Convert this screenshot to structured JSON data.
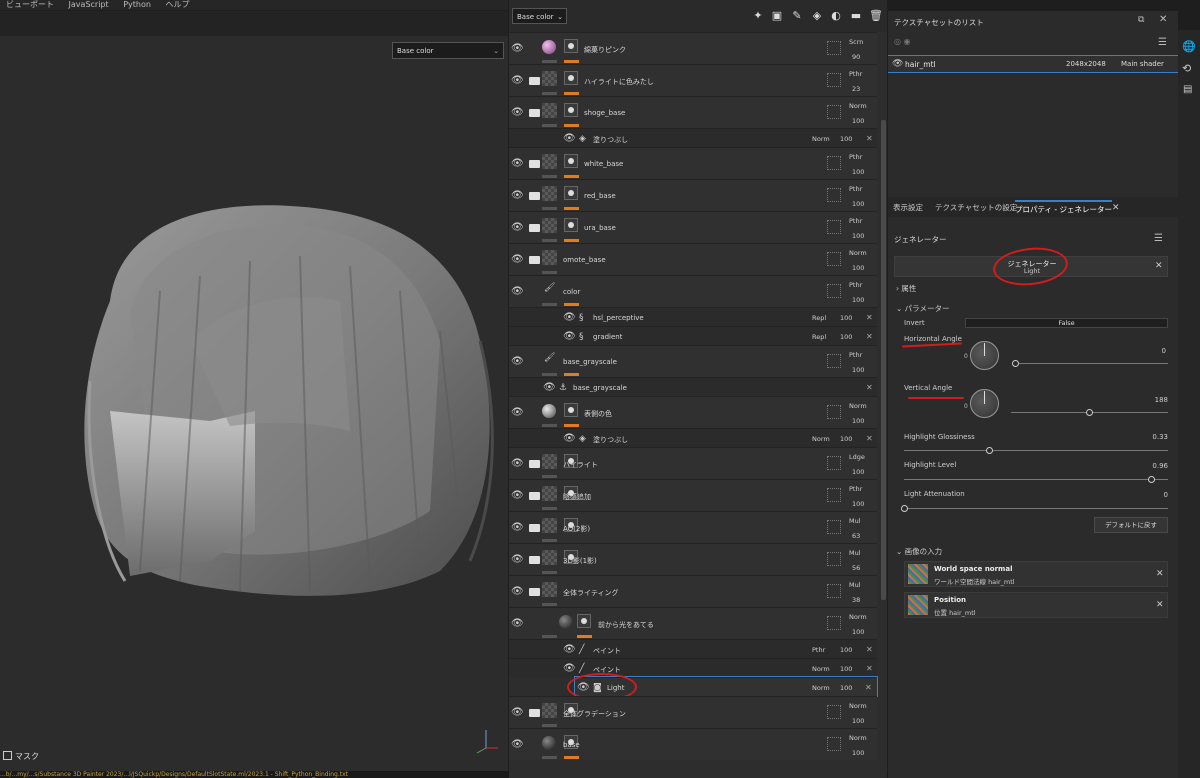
{
  "menu": [
    "ビューポート",
    "JavaScript",
    "Python",
    "ヘルプ"
  ],
  "viewport": {
    "channel_select": "Base color",
    "mask_label": "マスク",
    "status_text": "...b/...my/...s/Substance 3D Painter 2023/...l/JSQuickp/Designs/DefaultSlotState.ml/2023.1 - Shift_Python_Binding.txt"
  },
  "layers_toolbar": {
    "channel_select": "Base color",
    "icons": [
      "brush-effects-icon",
      "add-fill-icon",
      "paint-icon",
      "fill-icon",
      "mask-icon",
      "folder-icon",
      "trash-icon"
    ]
  },
  "layers": [
    {
      "name": "綿菓りピンク",
      "blend": "Scrn",
      "opacity": "90",
      "visible": true,
      "kind": "sphere-pink"
    },
    {
      "name": "ハイライトに色みたし",
      "blend": "Pthr",
      "opacity": "23",
      "visible": true,
      "kind": "folder"
    },
    {
      "name": "shoge_base",
      "blend": "Norm",
      "opacity": "100",
      "visible": true,
      "kind": "folder"
    },
    {
      "name": "塗りつぶし",
      "blend": "Norm",
      "opacity": "100",
      "visible": true,
      "kind": "fill-sub"
    },
    {
      "name": "white_base",
      "blend": "Pthr",
      "opacity": "100",
      "visible": true,
      "kind": "folder"
    },
    {
      "name": "red_base",
      "blend": "Pthr",
      "opacity": "100",
      "visible": true,
      "kind": "folder"
    },
    {
      "name": "ura_base",
      "blend": "Pthr",
      "opacity": "100",
      "visible": true,
      "kind": "folder"
    },
    {
      "name": "omote_base",
      "blend": "Norm",
      "opacity": "100",
      "visible": true,
      "kind": "folder-open"
    },
    {
      "name": "color",
      "blend": "Pthr",
      "opacity": "100",
      "visible": true,
      "kind": "paint"
    },
    {
      "name": "hsl_perceptive",
      "blend": "Repl",
      "opacity": "100",
      "visible": true,
      "kind": "filter-sub"
    },
    {
      "name": "gradient",
      "blend": "Repl",
      "opacity": "100",
      "visible": true,
      "kind": "filter-sub"
    },
    {
      "name": "base_grayscale",
      "blend": "Pthr",
      "opacity": "100",
      "visible": true,
      "kind": "paint"
    },
    {
      "name": "base_grayscale",
      "blend": "",
      "opacity": "",
      "visible": true,
      "kind": "anchor-sub"
    },
    {
      "name": "表側の色",
      "blend": "Norm",
      "opacity": "100",
      "visible": true,
      "kind": "sphere-gray"
    },
    {
      "name": "塗りつぶし",
      "blend": "Norm",
      "opacity": "100",
      "visible": true,
      "kind": "fill-sub"
    },
    {
      "name": "ハイライト",
      "blend": "Ldge",
      "opacity": "100",
      "visible": true,
      "kind": "folder"
    },
    {
      "name": "陰感追加",
      "blend": "Pthr",
      "opacity": "100",
      "visible": true,
      "kind": "folder"
    },
    {
      "name": "AO(2影)",
      "blend": "Mul",
      "opacity": "63",
      "visible": true,
      "kind": "folder"
    },
    {
      "name": "3D影(1影)",
      "blend": "Mul",
      "opacity": "56",
      "visible": true,
      "kind": "folder"
    },
    {
      "name": "全体ライティング",
      "blend": "Mul",
      "opacity": "38",
      "visible": true,
      "kind": "folder-open"
    },
    {
      "name": "前から光をあてる",
      "blend": "Norm",
      "opacity": "100",
      "visible": true,
      "kind": "sphere-dark"
    },
    {
      "name": "ペイント",
      "blend": "Pthr",
      "opacity": "100",
      "visible": true,
      "kind": "paint-sub"
    },
    {
      "name": "ペイント",
      "blend": "Norm",
      "opacity": "100",
      "visible": true,
      "kind": "paint-sub"
    },
    {
      "name": "Light",
      "blend": "Norm",
      "opacity": "100",
      "visible": true,
      "kind": "gen-sub"
    },
    {
      "name": "全体グラデーション",
      "blend": "Norm",
      "opacity": "100",
      "visible": true,
      "kind": "folder"
    },
    {
      "name": "base",
      "blend": "Norm",
      "opacity": "100",
      "visible": true,
      "kind": "sphere-dark"
    }
  ],
  "texture_list": {
    "title": "テクスチャセットのリスト",
    "row": {
      "name": "hair_mtl",
      "size": "2048x2048",
      "shader": "Main shader"
    }
  },
  "properties": {
    "tabs": [
      "表示設定",
      "テクスチャセットの設定",
      "プロパティ - ジェネレーター"
    ],
    "section_title": "ジェネレーター",
    "generator_name": "ジェネレーター",
    "generator_sub": "Light",
    "attrs_label": "属性",
    "params_label": "パラメーター",
    "invert_label": "Invert",
    "invert_value": "False",
    "h_angle_label": "Horizontal Angle",
    "h_angle_value": "0",
    "h_angle_min": "0",
    "v_angle_label": "Vertical Angle",
    "v_angle_value": "188",
    "v_angle_min": "0",
    "glossiness_label": "Highlight Glossiness",
    "glossiness_value": "0.33",
    "level_label": "Highlight Level",
    "level_value": "0.96",
    "atten_label": "Light Attenuation",
    "atten_value": "0",
    "reset_button": "デフォルトに戻す",
    "inputs_label": "画像の入力",
    "inputs": [
      {
        "title": "World space normal",
        "sub": "ワールド空間法線 hair_mtl"
      },
      {
        "title": "Position",
        "sub": "位置 hair_mtl"
      }
    ]
  },
  "slider_levels": {
    "h_angle": 0.0,
    "v_angle": 0.52,
    "glossiness": 0.33,
    "level": 0.96,
    "atten": 0.0
  }
}
